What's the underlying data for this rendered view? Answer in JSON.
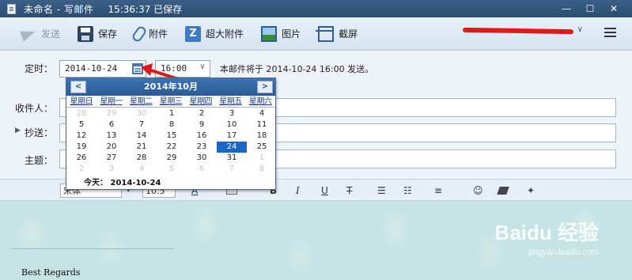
{
  "window": {
    "title": "未命名 - 写邮件",
    "save_status": "15:36:37 已保存",
    "min": "—",
    "max": "☐",
    "close": "✕"
  },
  "toolbar": {
    "send": "发送",
    "save": "保存",
    "attach": "附件",
    "big_attach": "超大附件",
    "big_attach_icon_letter": "Z",
    "image": "图片",
    "screenshot": "截屏",
    "account_caret": "∨"
  },
  "schedule": {
    "label": "定时：",
    "date": "2014-10-24",
    "time": "16:00",
    "time_caret": "∨",
    "note": "本邮件将于 2014-10-24 16:00 发送。"
  },
  "calendar": {
    "title": "2014年10月",
    "prev": "<",
    "next": ">",
    "weekdays": [
      "星期日",
      "星期一",
      "星期二",
      "星期三",
      "星期四",
      "星期五",
      "星期六"
    ],
    "days": [
      {
        "d": "28",
        "t": "other"
      },
      {
        "d": "29",
        "t": "other"
      },
      {
        "d": "30",
        "t": "other"
      },
      {
        "d": "1"
      },
      {
        "d": "2"
      },
      {
        "d": "3"
      },
      {
        "d": "4"
      },
      {
        "d": "5"
      },
      {
        "d": "6"
      },
      {
        "d": "7"
      },
      {
        "d": "8"
      },
      {
        "d": "9"
      },
      {
        "d": "10"
      },
      {
        "d": "11"
      },
      {
        "d": "12"
      },
      {
        "d": "13"
      },
      {
        "d": "14"
      },
      {
        "d": "15"
      },
      {
        "d": "16"
      },
      {
        "d": "17"
      },
      {
        "d": "18"
      },
      {
        "d": "19"
      },
      {
        "d": "20"
      },
      {
        "d": "21"
      },
      {
        "d": "22"
      },
      {
        "d": "23"
      },
      {
        "d": "24",
        "t": "selected"
      },
      {
        "d": "25"
      },
      {
        "d": "26"
      },
      {
        "d": "27"
      },
      {
        "d": "28"
      },
      {
        "d": "29"
      },
      {
        "d": "30"
      },
      {
        "d": "31"
      },
      {
        "d": "1",
        "t": "other"
      },
      {
        "d": "2",
        "t": "other"
      },
      {
        "d": "3",
        "t": "other"
      },
      {
        "d": "4",
        "t": "other"
      },
      {
        "d": "5",
        "t": "other"
      },
      {
        "d": "6",
        "t": "other"
      },
      {
        "d": "7",
        "t": "other"
      },
      {
        "d": "8",
        "t": "other"
      }
    ],
    "today": "今天：  2014-10-24"
  },
  "fields": {
    "to_label": "收件人：",
    "cc_toggle": "▶",
    "cc_label": "抄送：",
    "subject_label": "主题："
  },
  "format": {
    "font": "宋体",
    "size": "10.5",
    "bold": "B",
    "italic": "I",
    "underline": "U",
    "strike": "T",
    "ul": "☰",
    "ol": "☷",
    "align": "≡",
    "emoji": "☺",
    "a_color": "A"
  },
  "editor": {
    "signature": "Best Regards"
  },
  "watermark": {
    "brand": "Baidu 经验",
    "url": "jingyan.baidu.com"
  },
  "colors": {
    "accent": "#1866c8",
    "annotation_red": "#e01818"
  }
}
